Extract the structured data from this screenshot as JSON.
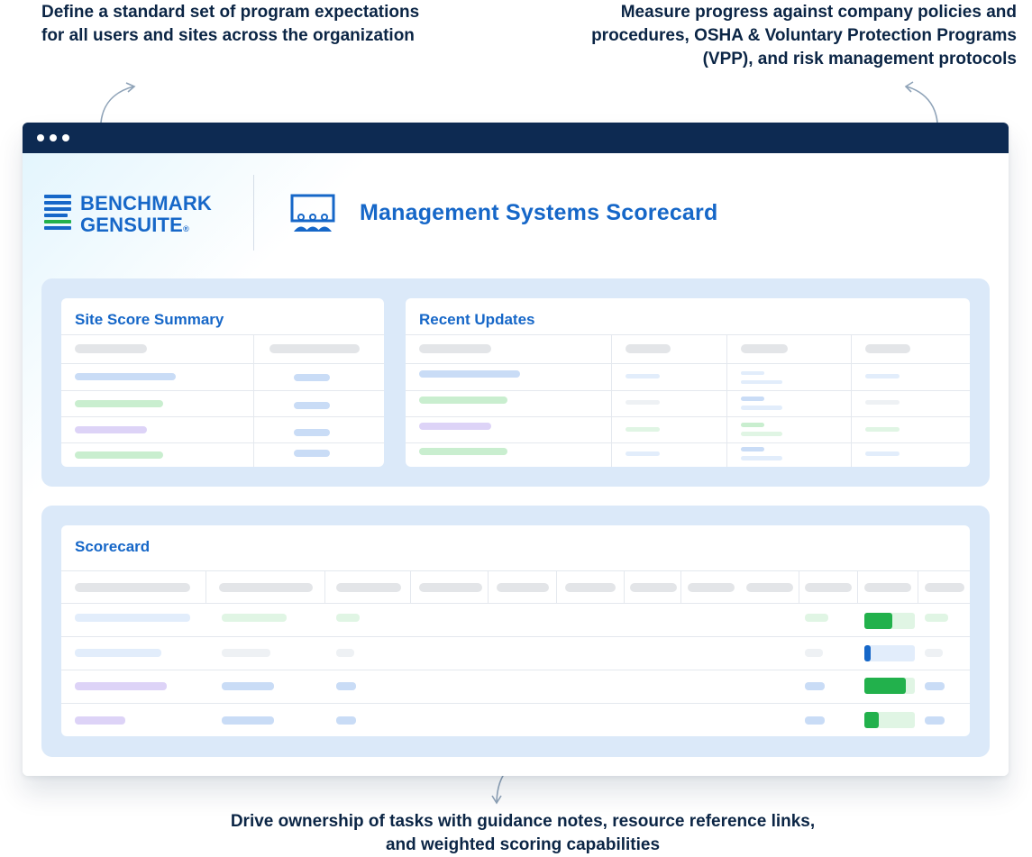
{
  "callouts": {
    "top_left": "Define a standard set of program expectations for all users and sites across the organization",
    "top_right": "Measure progress against company policies and procedures, OSHA & Voluntary Protection Programs (VPP), and risk management protocols",
    "bottom": "Drive ownership of tasks with guidance notes, resource reference links, and weighted scoring capabilities"
  },
  "logo": {
    "line1": "BENCHMARK",
    "line2": "GENSUITE",
    "registered": "®",
    "icon": "stacked-lines-logo-icon"
  },
  "app": {
    "title": "Management Systems Scorecard",
    "icon": "people-board-icon"
  },
  "cards": {
    "site_score_summary": {
      "title": "Site Score Summary"
    },
    "recent_updates": {
      "title": "Recent Updates"
    },
    "scorecard": {
      "title": "Scorecard"
    }
  },
  "scorecard_progress": [
    0.55,
    0.12,
    0.82,
    0.28
  ],
  "colors": {
    "brand_blue": "#1667c8",
    "navy": "#0d2a52",
    "panel_bg": "#dbe9f9",
    "progress_green": "#22b14c",
    "progress_blue": "#1667c8"
  }
}
